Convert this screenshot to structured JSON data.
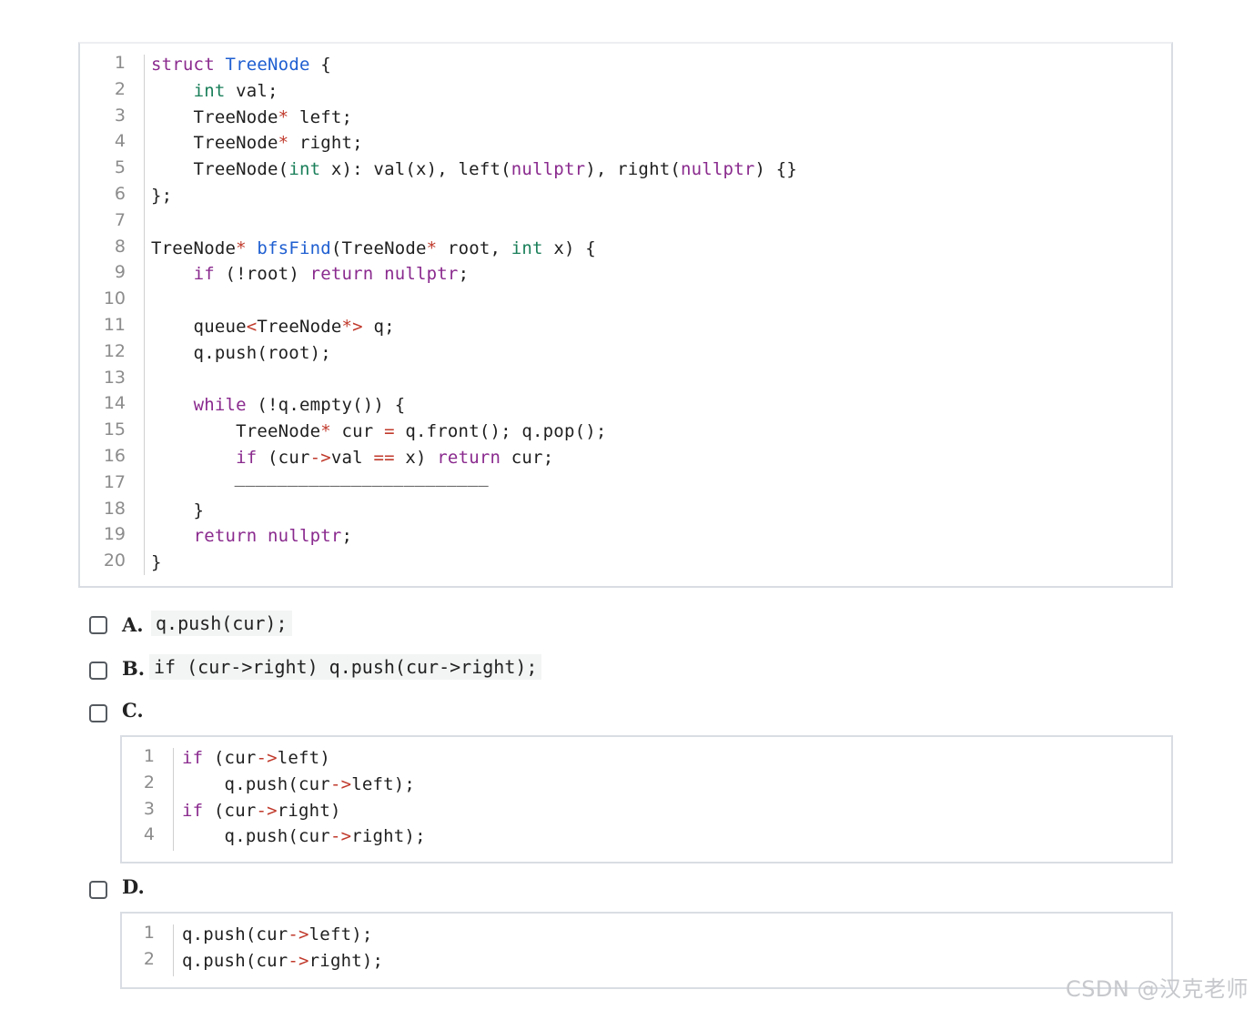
{
  "main_code": {
    "line_numbers": [
      "1",
      "2",
      "3",
      "4",
      "5",
      "6",
      "7",
      "8",
      "9",
      "10",
      "11",
      "12",
      "13",
      "14",
      "15",
      "16",
      "17",
      "18",
      "19",
      "20"
    ],
    "lines": [
      [
        {
          "t": "struct ",
          "c": "kw"
        },
        {
          "t": "TreeNode",
          "c": "fn"
        },
        {
          "t": " {",
          "c": "pl"
        }
      ],
      [
        {
          "t": "    ",
          "c": "pl"
        },
        {
          "t": "int",
          "c": "ty"
        },
        {
          "t": " val;",
          "c": "pl"
        }
      ],
      [
        {
          "t": "    TreeNode",
          "c": "pl"
        },
        {
          "t": "*",
          "c": "op"
        },
        {
          "t": " left;",
          "c": "pl"
        }
      ],
      [
        {
          "t": "    TreeNode",
          "c": "pl"
        },
        {
          "t": "*",
          "c": "op"
        },
        {
          "t": " right;",
          "c": "pl"
        }
      ],
      [
        {
          "t": "    TreeNode(",
          "c": "pl"
        },
        {
          "t": "int",
          "c": "ty"
        },
        {
          "t": " x): val(x), left(",
          "c": "pl"
        },
        {
          "t": "nullptr",
          "c": "lit"
        },
        {
          "t": "), right(",
          "c": "pl"
        },
        {
          "t": "nullptr",
          "c": "lit"
        },
        {
          "t": ") {}",
          "c": "pl"
        }
      ],
      [
        {
          "t": "};",
          "c": "pl"
        }
      ],
      [
        {
          "t": "",
          "c": "pl"
        }
      ],
      [
        {
          "t": "TreeNode",
          "c": "pl"
        },
        {
          "t": "*",
          "c": "op"
        },
        {
          "t": " ",
          "c": "pl"
        },
        {
          "t": "bfsFind",
          "c": "fn"
        },
        {
          "t": "(TreeNode",
          "c": "pl"
        },
        {
          "t": "*",
          "c": "op"
        },
        {
          "t": " root, ",
          "c": "pl"
        },
        {
          "t": "int",
          "c": "ty"
        },
        {
          "t": " x) {",
          "c": "pl"
        }
      ],
      [
        {
          "t": "    ",
          "c": "pl"
        },
        {
          "t": "if",
          "c": "kw"
        },
        {
          "t": " (!root) ",
          "c": "pl"
        },
        {
          "t": "return",
          "c": "kw"
        },
        {
          "t": " ",
          "c": "pl"
        },
        {
          "t": "nullptr",
          "c": "lit"
        },
        {
          "t": ";",
          "c": "pl"
        }
      ],
      [
        {
          "t": "",
          "c": "pl"
        }
      ],
      [
        {
          "t": "    queue",
          "c": "pl"
        },
        {
          "t": "<",
          "c": "op"
        },
        {
          "t": "TreeNode",
          "c": "pl"
        },
        {
          "t": "*>",
          "c": "op"
        },
        {
          "t": " q;",
          "c": "pl"
        }
      ],
      [
        {
          "t": "    q.push(root);",
          "c": "pl"
        }
      ],
      [
        {
          "t": "",
          "c": "pl"
        }
      ],
      [
        {
          "t": "    ",
          "c": "pl"
        },
        {
          "t": "while",
          "c": "kw"
        },
        {
          "t": " (!q.empty()) {",
          "c": "pl"
        }
      ],
      [
        {
          "t": "        TreeNode",
          "c": "pl"
        },
        {
          "t": "*",
          "c": "op"
        },
        {
          "t": " cur ",
          "c": "pl"
        },
        {
          "t": "=",
          "c": "op"
        },
        {
          "t": " q.front(); q.pop();",
          "c": "pl"
        }
      ],
      [
        {
          "t": "        ",
          "c": "pl"
        },
        {
          "t": "if",
          "c": "kw"
        },
        {
          "t": " (cur",
          "c": "pl"
        },
        {
          "t": "->",
          "c": "op"
        },
        {
          "t": "val ",
          "c": "pl"
        },
        {
          "t": "==",
          "c": "op"
        },
        {
          "t": " x) ",
          "c": "pl"
        },
        {
          "t": "return",
          "c": "kw"
        },
        {
          "t": " cur;",
          "c": "pl"
        }
      ],
      [
        {
          "t": "",
          "c": "pl"
        }
      ],
      [
        {
          "t": "    }",
          "c": "pl"
        }
      ],
      [
        {
          "t": "    ",
          "c": "pl"
        },
        {
          "t": "return",
          "c": "kw"
        },
        {
          "t": " ",
          "c": "pl"
        },
        {
          "t": "nullptr",
          "c": "lit"
        },
        {
          "t": ";",
          "c": "pl"
        }
      ],
      [
        {
          "t": "}",
          "c": "pl"
        }
      ]
    ],
    "blank_fill": "________________________"
  },
  "options": {
    "a": {
      "letter": "A.",
      "code": "q.push(cur);"
    },
    "b": {
      "letter": "B.",
      "code": "if (cur->right) q.push(cur->right);"
    },
    "c": {
      "letter": "C.",
      "line_numbers": [
        "1",
        "2",
        "3",
        "4"
      ],
      "lines": [
        [
          {
            "t": "if",
            "c": "kw"
          },
          {
            "t": " (cur",
            "c": "pl"
          },
          {
            "t": "->",
            "c": "op"
          },
          {
            "t": "left)",
            "c": "pl"
          }
        ],
        [
          {
            "t": "    q.push(cur",
            "c": "pl"
          },
          {
            "t": "->",
            "c": "op"
          },
          {
            "t": "left);",
            "c": "pl"
          }
        ],
        [
          {
            "t": "if",
            "c": "kw"
          },
          {
            "t": " (cur",
            "c": "pl"
          },
          {
            "t": "->",
            "c": "op"
          },
          {
            "t": "right)",
            "c": "pl"
          }
        ],
        [
          {
            "t": "    q.push(cur",
            "c": "pl"
          },
          {
            "t": "->",
            "c": "op"
          },
          {
            "t": "right);",
            "c": "pl"
          }
        ]
      ]
    },
    "d": {
      "letter": "D.",
      "line_numbers": [
        "1",
        "2"
      ],
      "lines": [
        [
          {
            "t": "q.push(cur",
            "c": "pl"
          },
          {
            "t": "->",
            "c": "op"
          },
          {
            "t": "left);",
            "c": "pl"
          }
        ],
        [
          {
            "t": "q.push(cur",
            "c": "pl"
          },
          {
            "t": "->",
            "c": "op"
          },
          {
            "t": "right);",
            "c": "pl"
          }
        ]
      ]
    }
  },
  "watermark": "CSDN @汉克老师"
}
